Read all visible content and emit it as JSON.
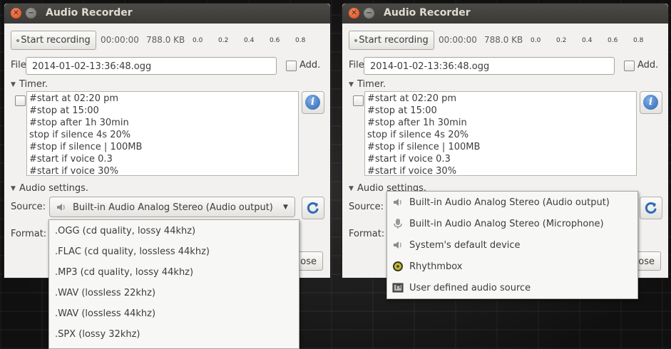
{
  "left": {
    "title": "Audio Recorder",
    "start_label": "Start recording",
    "time": "00:00:00",
    "size": "788.0 KB",
    "ticks": [
      "0.0",
      "0.2",
      "0.4",
      "0.6",
      "0.8"
    ],
    "file_label": "File:",
    "file_value": "2014-01-02-13:36:48.ogg",
    "add_label": "Add.",
    "timer_label": "Timer.",
    "timer_lines": [
      "#start at 02:20 pm",
      "#stop at 15:00",
      "#stop after 1h 30min",
      "stop if silence 4s 20%",
      "#stop if silence | 100MB",
      "#start if voice 0.3",
      "#start if voice 30%"
    ],
    "audio_settings_label": "Audio settings.",
    "source_label": "Source:",
    "source_value": "Built-in Audio Analog Stereo (Audio output)",
    "format_label": "Format:",
    "close_label": "lose",
    "format_options": [
      ".OGG  (cd quality, lossy 44khz)",
      ".FLAC  (cd quality, lossless 44khz)",
      ".MP3  (cd quality, lossy 44khz)",
      ".WAV  (lossless 22khz)",
      ".WAV  (lossless 44khz)",
      ".SPX  (lossy 32khz)"
    ]
  },
  "right": {
    "title": "Audio Recorder",
    "start_label": "Start recording",
    "time": "00:00:00",
    "size": "788.0 KB",
    "ticks": [
      "0.0",
      "0.2",
      "0.4",
      "0.6",
      "0.8"
    ],
    "file_label": "File:",
    "file_value": "2014-01-02-13:36:48.ogg",
    "add_label": "Add.",
    "timer_label": "Timer.",
    "timer_lines": [
      "#start at 02:20 pm",
      "#stop at 15:00",
      "#stop after 1h 30min",
      "stop if silence 4s 20%",
      "#stop if silence | 100MB",
      "#start if voice 0.3",
      "#start if voice 30%"
    ],
    "audio_settings_label": "Audio settings.",
    "source_label": "Source:",
    "format_label": "Format:",
    "close_label": "lose",
    "source_options": [
      {
        "label": "Built-in Audio Analog Stereo (Audio output)",
        "icon": "speaker-icon"
      },
      {
        "label": "Built-in Audio Analog Stereo (Microphone)",
        "icon": "microphone-icon"
      },
      {
        "label": "System's default device",
        "icon": "speaker-icon"
      },
      {
        "label": "Rhythmbox",
        "icon": "rhythmbox-icon"
      },
      {
        "label": "User defined audio source",
        "icon": "audio-source-icon"
      }
    ]
  },
  "colors": {
    "titlebar": "#3c3b37",
    "close_button": "#e95420",
    "info": "#3465a4"
  }
}
